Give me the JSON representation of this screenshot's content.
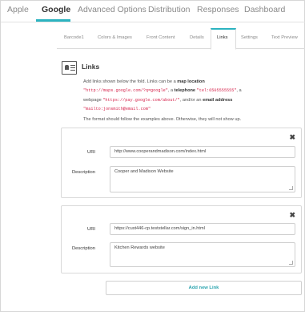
{
  "platform_tabs": [
    {
      "label": "Apple"
    },
    {
      "label": "Google"
    },
    {
      "label": "Advanced Options"
    },
    {
      "label": "Distribution"
    },
    {
      "label": "Responses"
    },
    {
      "label": "Dashboard"
    }
  ],
  "active_platform_tab": "Google",
  "sub_tabs": [
    {
      "label": "Barcode1"
    },
    {
      "label": "Colors & Images"
    },
    {
      "label": "Front Content"
    },
    {
      "label": "Details"
    },
    {
      "label": "Links"
    },
    {
      "label": "Settings"
    },
    {
      "label": "Text Preview"
    }
  ],
  "active_sub_tab": "Links",
  "section": {
    "title": "Links",
    "icon": "contact-card-icon",
    "desc_intro": "Add links shown below the fold. Links can be a ",
    "desc_map": "map location",
    "code_map": "\"http://maps.google.com/?q=google\"",
    "desc_sep1": ", a ",
    "desc_tel": "telephone",
    "code_tel": "\"tel:6505555555\"",
    "desc_sep2": ", a webpage ",
    "code_web": "\"https://pay.google.com/about/\"",
    "desc_sep3": ", and/or an ",
    "desc_email": "email address",
    "code_email": "\"mailto:jonsmith@email.com\"",
    "note": "The format should follow the examples above. Otherwise, they will not show up."
  },
  "links": [
    {
      "uri_label": "URI",
      "uri_value": "http://www.cooperandmadison.com/index.html",
      "description_label": "Description",
      "description_value": "Cooper and Madison Website"
    },
    {
      "uri_label": "URI",
      "uri_value": "https://cust446-cp.teststellar.com/sign_in.html",
      "description_label": "Description",
      "description_value": "Kitchen Rewards website"
    }
  ],
  "close_glyph": "✖",
  "add_button_label": "Add new Link",
  "colors": {
    "accent": "#2bb3c0",
    "code_red": "#d6254d"
  }
}
